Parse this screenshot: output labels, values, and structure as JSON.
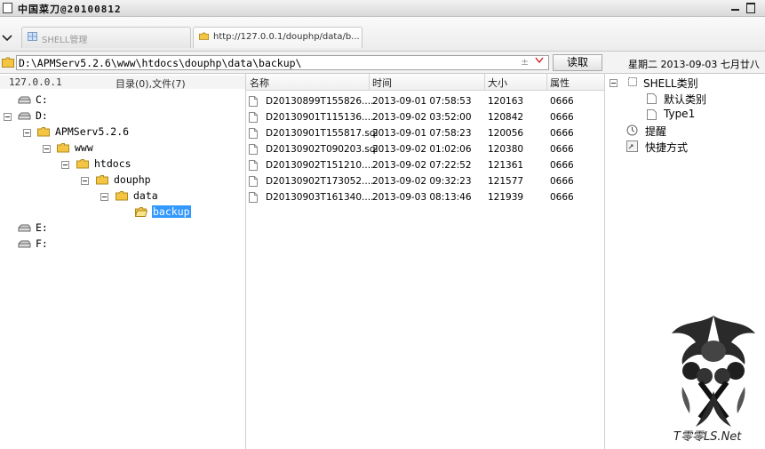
{
  "window": {
    "title": "中国菜刀@20100812"
  },
  "tabs": [
    {
      "label": "SHELL管理"
    },
    {
      "label": "http://127.0.0.1/douphp/data/b..."
    }
  ],
  "address": {
    "path": "D:\\APMServ5.2.6\\www\\htdocs\\douphp\\data\\backup\\",
    "plusminus": "±",
    "read_button": "读取",
    "date": "星期二 2013-09-03 七月廿八"
  },
  "tree": {
    "host": "127.0.0.1",
    "stats": "目录(0),文件(7)",
    "nodes": [
      {
        "label": "C:"
      },
      {
        "label": "D:"
      },
      {
        "label": "APMServ5.2.6"
      },
      {
        "label": "www"
      },
      {
        "label": "htdocs"
      },
      {
        "label": "douphp"
      },
      {
        "label": "data"
      },
      {
        "label": "backup"
      },
      {
        "label": "E:"
      },
      {
        "label": "F:"
      }
    ]
  },
  "files": {
    "columns": [
      "名称",
      "时间",
      "大小",
      "属性"
    ],
    "rows": [
      {
        "name": "D20130899T155826....",
        "time": "2013-09-01 07:58:53",
        "size": "120163",
        "attr": "0666"
      },
      {
        "name": "D20130901T115136....",
        "time": "2013-09-02 03:52:00",
        "size": "120842",
        "attr": "0666"
      },
      {
        "name": "D20130901T155817.sql",
        "time": "2013-09-01 07:58:23",
        "size": "120056",
        "attr": "0666"
      },
      {
        "name": "D20130902T090203.sql",
        "time": "2013-09-02 01:02:06",
        "size": "120380",
        "attr": "0666"
      },
      {
        "name": "D20130902T151210....",
        "time": "2013-09-02 07:22:52",
        "size": "121361",
        "attr": "0666"
      },
      {
        "name": "D20130902T173052....",
        "time": "2013-09-02 09:32:23",
        "size": "121577",
        "attr": "0666"
      },
      {
        "name": "D20130903T161340....",
        "time": "2013-09-03 08:13:46",
        "size": "121939",
        "attr": "0666"
      }
    ]
  },
  "right_panel": {
    "shell_category": "SHELL类别",
    "default_category": "默认类别",
    "type1": "Type1",
    "reminder": "提醒",
    "shortcut": "快捷方式"
  },
  "watermark": {
    "text": "T零零LS.Net"
  },
  "colors": {
    "selection": "#3399ff",
    "folder": "#f4c542",
    "accent_red": "#cc2222"
  }
}
